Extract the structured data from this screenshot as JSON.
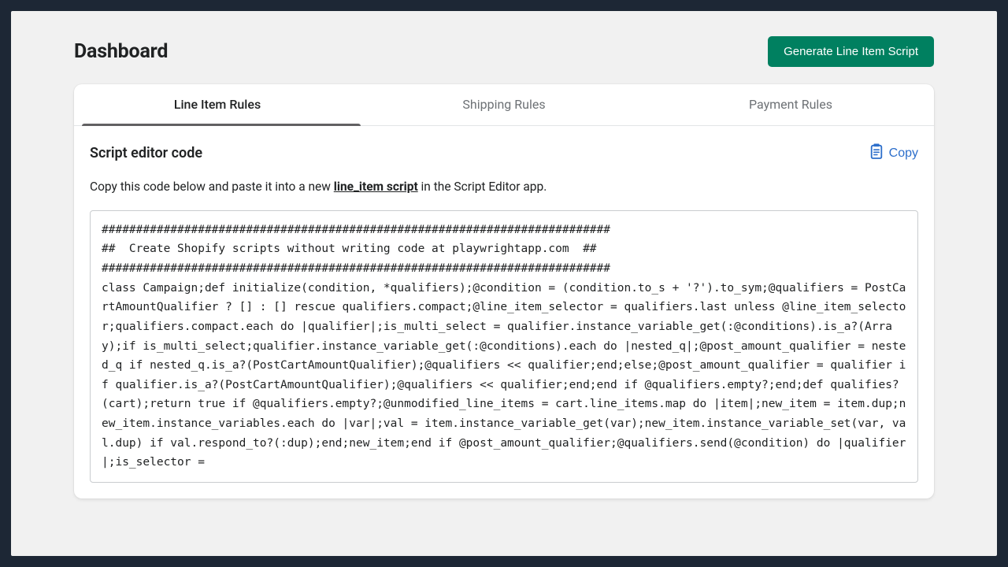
{
  "header": {
    "title": "Dashboard",
    "generate_button": "Generate Line Item Script"
  },
  "tabs": [
    {
      "label": "Line Item Rules",
      "active": true
    },
    {
      "label": "Shipping Rules",
      "active": false
    },
    {
      "label": "Payment Rules",
      "active": false
    }
  ],
  "section": {
    "title": "Script editor code",
    "copy_label": "Copy",
    "instruction_pre": "Copy this code below and paste it into a new ",
    "instruction_link": "line_item script",
    "instruction_post": " in the Script Editor app."
  },
  "code": "##########################################################################\n##  Create Shopify scripts without writing code at playwrightapp.com  ##\n##########################################################################\nclass Campaign;def initialize(condition, *qualifiers);@condition = (condition.to_s + '?').to_sym;@qualifiers = PostCartAmountQualifier ? [] : [] rescue qualifiers.compact;@line_item_selector = qualifiers.last unless @line_item_selector;qualifiers.compact.each do |qualifier|;is_multi_select = qualifier.instance_variable_get(:@conditions).is_a?(Array);if is_multi_select;qualifier.instance_variable_get(:@conditions).each do |nested_q|;@post_amount_qualifier = nested_q if nested_q.is_a?(PostCartAmountQualifier);@qualifiers << qualifier;end;else;@post_amount_qualifier = qualifier if qualifier.is_a?(PostCartAmountQualifier);@qualifiers << qualifier;end;end if @qualifiers.empty?;end;def qualifies?(cart);return true if @qualifiers.empty?;@unmodified_line_items = cart.line_items.map do |item|;new_item = item.dup;new_item.instance_variables.each do |var|;val = item.instance_variable_get(var);new_item.instance_variable_set(var, val.dup) if val.respond_to?(:dup);end;new_item;end if @post_amount_qualifier;@qualifiers.send(@condition) do |qualifier|;is_selector ="
}
